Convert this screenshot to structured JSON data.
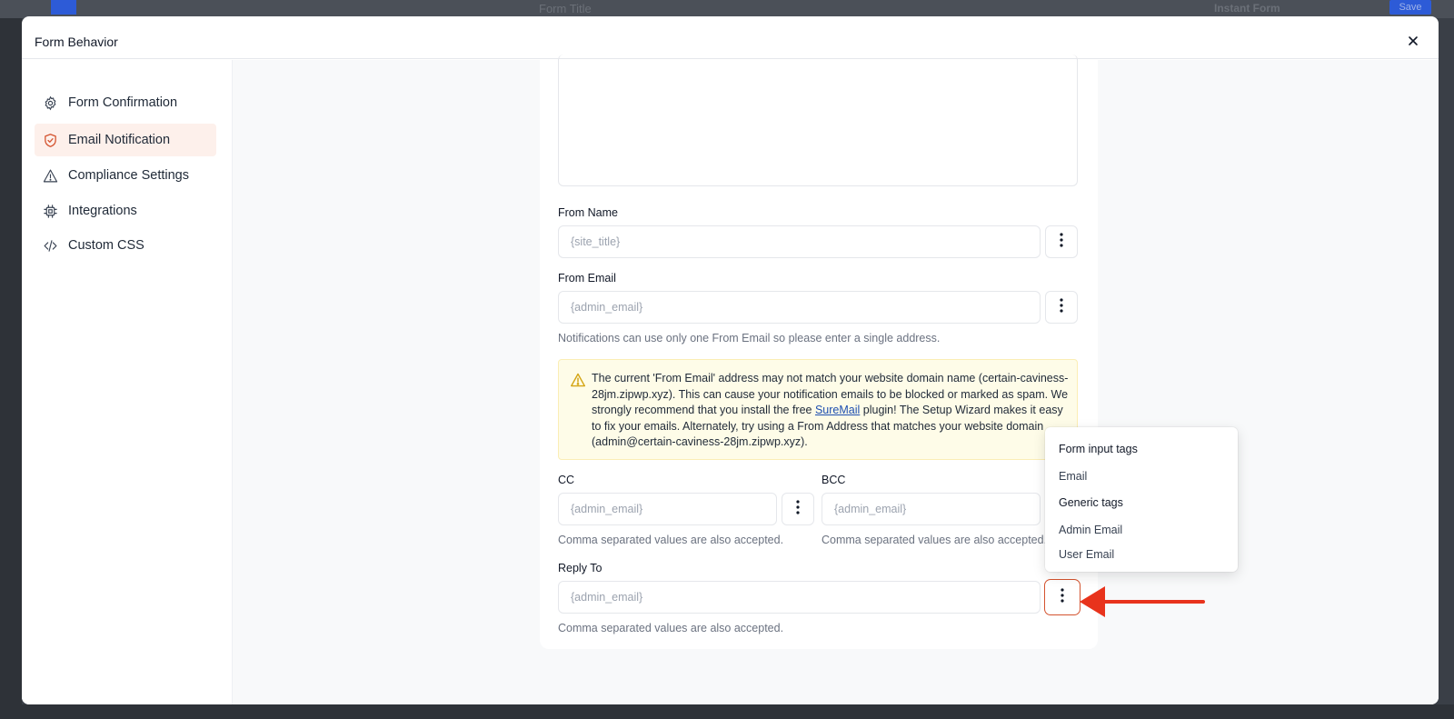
{
  "background": {
    "title": "Form Title",
    "instant_form": "Instant Form",
    "save_label": "Save"
  },
  "modal": {
    "title": "Form Behavior",
    "close_icon": "close-icon"
  },
  "sidebar": {
    "items": [
      {
        "label": "Form Confirmation",
        "icon": "gear-icon"
      },
      {
        "label": "Email Notification",
        "icon": "shield-icon"
      },
      {
        "label": "Compliance Settings",
        "icon": "warning-icon"
      },
      {
        "label": "Integrations",
        "icon": "chip-icon"
      },
      {
        "label": "Custom CSS",
        "icon": "code-icon"
      }
    ],
    "active_index": 1
  },
  "form": {
    "from_name": {
      "label": "From Name",
      "placeholder": "{site_title}"
    },
    "from_email": {
      "label": "From Email",
      "placeholder": "{admin_email}",
      "help": "Notifications can use only one From Email so please enter a single address."
    },
    "warning": {
      "text_before_link": "The current 'From Email' address may not match your website domain name (certain-caviness-28jm.zipwp.xyz). This can cause your notification emails to be blocked or marked as spam. We strongly recommend that you install the free ",
      "link_text": "SureMail",
      "text_after_link": " plugin! The Setup Wizard makes it easy to fix your emails. Alternately, try using a From Address that matches your website domain (admin@certain-caviness-28jm.zipwp.xyz)."
    },
    "cc": {
      "label": "CC",
      "placeholder": "{admin_email}",
      "help": "Comma separated values are also accepted."
    },
    "bcc": {
      "label": "BCC",
      "placeholder": "{admin_email}",
      "help": "Comma separated values are also accepted."
    },
    "reply_to": {
      "label": "Reply To",
      "placeholder": "{admin_email}",
      "help": "Comma separated values are also accepted."
    }
  },
  "dropdown": {
    "form_input_heading": "Form input tags",
    "form_input_items": [
      "Email"
    ],
    "generic_heading": "Generic tags",
    "generic_items": [
      "Admin Email",
      "User Email"
    ]
  },
  "colors": {
    "accent": "#d4532f",
    "active_bg": "#fdf0eb",
    "warning_bg": "#fefce8",
    "arrow": "#e8331c"
  }
}
